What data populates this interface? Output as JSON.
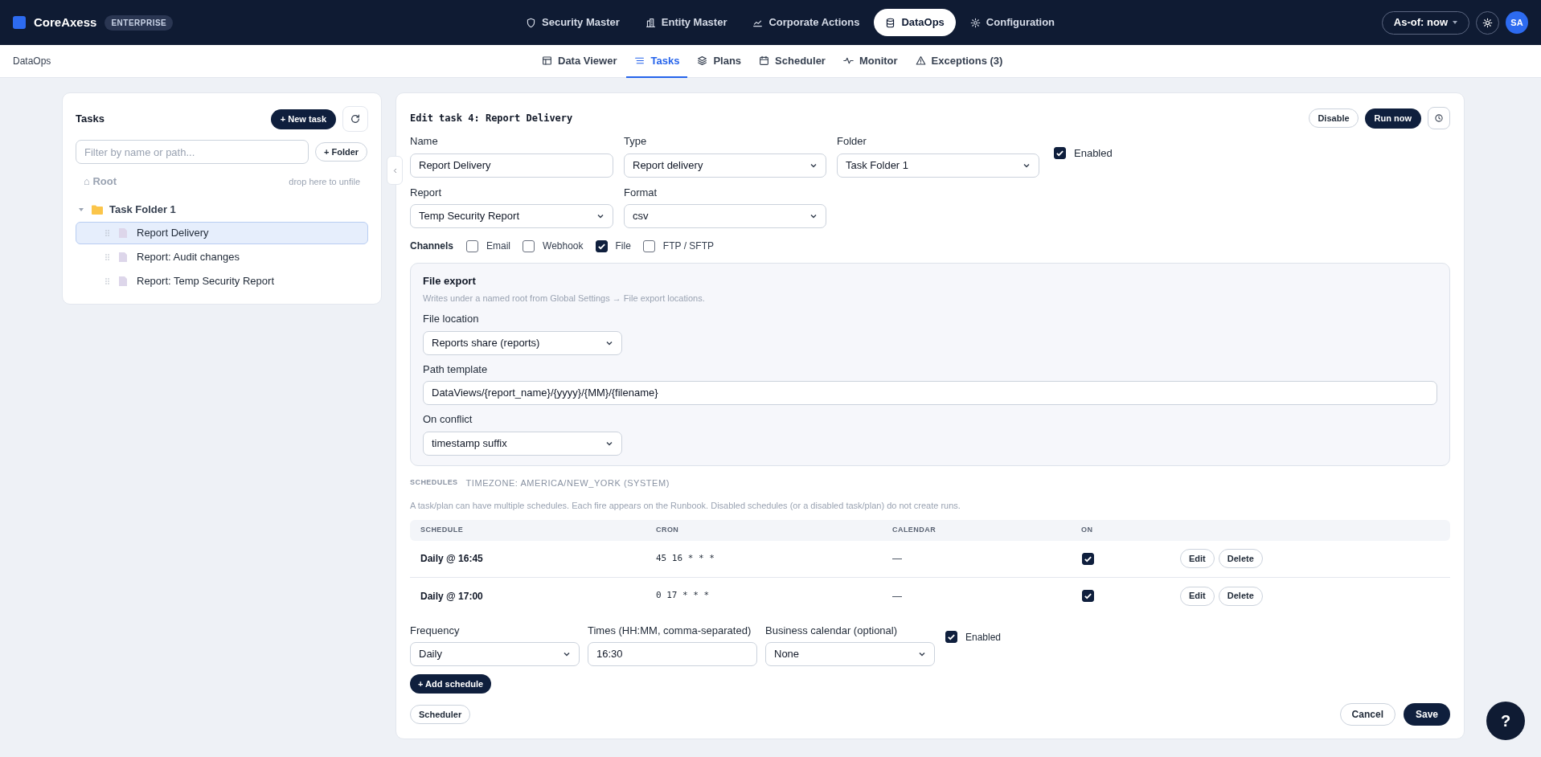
{
  "app": {
    "name": "CoreAxess",
    "badge": "ENTERPRISE"
  },
  "top_nav": [
    {
      "label": "Security Master",
      "selected": false
    },
    {
      "label": "Entity Master",
      "selected": false
    },
    {
      "label": "Corporate Actions",
      "selected": false
    },
    {
      "label": "DataOps",
      "selected": true
    },
    {
      "label": "Configuration",
      "selected": false
    }
  ],
  "as_of": "As-of: now",
  "avatar": "SA",
  "breadcrumb": "DataOps",
  "sub_nav": [
    {
      "label": "Data Viewer",
      "selected": false
    },
    {
      "label": "Tasks",
      "selected": true
    },
    {
      "label": "Plans",
      "selected": false
    },
    {
      "label": "Scheduler",
      "selected": false
    },
    {
      "label": "Monitor",
      "selected": false
    },
    {
      "label": "Exceptions (3)",
      "selected": false
    }
  ],
  "sidebar": {
    "title": "Tasks",
    "new_button": "+ New task",
    "filter_placeholder": "Filter by name or path...",
    "folder_button": "+ Folder",
    "root": "⌂ Root",
    "drop_hint": "drop here to unfile",
    "tree": [
      {
        "label": "Task Folder 1",
        "expanded": true,
        "children": [
          {
            "label": "Report Delivery",
            "selected": true
          },
          {
            "label": "Report: Audit changes",
            "selected": false
          },
          {
            "label": "Report: Temp Security Report",
            "selected": false
          }
        ]
      }
    ]
  },
  "editor": {
    "title": "Edit task 4: Report Delivery",
    "disable_button": "Disable",
    "run_button": "Run now",
    "name": {
      "label": "Name",
      "value": "Report Delivery"
    },
    "type": {
      "label": "Type",
      "value": "Report delivery"
    },
    "folder": {
      "label": "Folder",
      "value": "Task Folder 1"
    },
    "enabled": {
      "label": "Enabled",
      "checked": true
    },
    "report": {
      "label": "Report",
      "value": "Temp Security Report"
    },
    "format": {
      "label": "Format",
      "value": "csv"
    },
    "channels_label": "Channels",
    "channels": [
      {
        "label": "Email",
        "checked": false
      },
      {
        "label": "Webhook",
        "checked": false
      },
      {
        "label": "File",
        "checked": true
      },
      {
        "label": "FTP / SFTP",
        "checked": false
      }
    ],
    "file_export": {
      "title": "File export",
      "hint": "Writes under a named root from Global Settings → File export locations.",
      "location": {
        "label": "File location",
        "value": "Reports share (reports)"
      },
      "path": {
        "label": "Path template",
        "value": "DataViews/{report_name}/{yyyy}/{MM}/{filename}"
      },
      "conflict": {
        "label": "On conflict",
        "value": "timestamp suffix"
      }
    },
    "schedules_heading": "SCHEDULES",
    "timezone": "TIMEZONE: AMERICA/NEW_YORK (SYSTEM)",
    "schedules_hint": "A task/plan can have multiple schedules. Each fire appears on the Runbook. Disabled schedules (or a disabled task/plan) do not create runs.",
    "table": {
      "columns": [
        "SCHEDULE",
        "CRON",
        "CALENDAR",
        "ON"
      ],
      "rows": [
        {
          "schedule": "Daily @ 16:45",
          "cron": "45 16 * * *",
          "calendar": "—",
          "on": true,
          "edit": "Edit",
          "delete": "Delete"
        },
        {
          "schedule": "Daily @ 17:00",
          "cron": "0 17 * * *",
          "calendar": "—",
          "on": true,
          "edit": "Edit",
          "delete": "Delete"
        }
      ]
    },
    "new_schedule": {
      "frequency": {
        "label": "Frequency",
        "value": "Daily"
      },
      "times": {
        "label": "Times (HH:MM, comma-separated)",
        "value": "16:30"
      },
      "calendar": {
        "label": "Business calendar (optional)",
        "value": "None"
      },
      "enabled": {
        "label": "Enabled",
        "checked": true
      },
      "add_button": "+ Add schedule"
    },
    "scheduler_button": "Scheduler",
    "cancel_button": "Cancel",
    "save_button": "Save"
  },
  "help_button": "?"
}
